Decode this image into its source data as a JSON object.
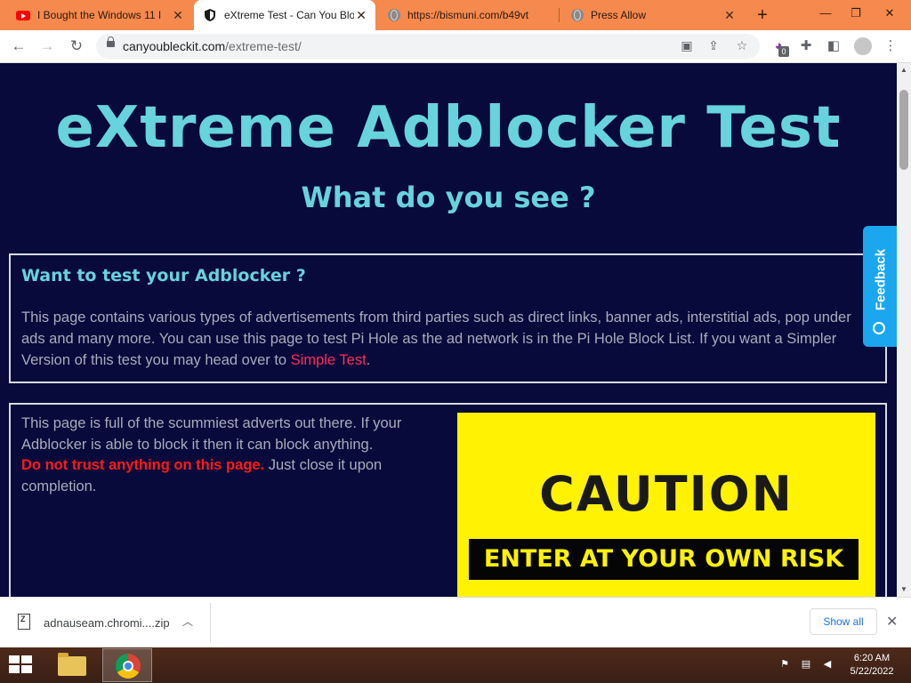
{
  "browser": {
    "tabs": [
      {
        "title": "I Bought the Windows 11 I",
        "favicon": "youtube-icon",
        "active": false
      },
      {
        "title": "eXtreme Test - Can You Blo",
        "favicon": "shield-icon",
        "active": true
      },
      {
        "title": "https://bismuni.com/b49vt",
        "favicon": "globe-icon",
        "active": false
      },
      {
        "title": "Press Allow",
        "favicon": "globe-icon",
        "active": false
      }
    ],
    "tab_close": "✕",
    "new_tab": "+",
    "window_controls": {
      "minimize": "—",
      "restore": "❐",
      "close": "✕"
    },
    "url_domain": "canyoubleckit.com",
    "url_path": "/extreme-test/",
    "extension_badge": "0"
  },
  "page": {
    "title": "eXtreme Adblocker Test",
    "subtitle": "What do you see ?",
    "intro": {
      "heading": "Want to test your Adblocker ?",
      "text_before": "This page contains various types of advertisements from third parties such as direct links, banner ads, interstitial ads, pop under ads and many more. You can use this page to test Pi Hole as the ad network is in the Pi Hole Block List. If you want a Simpler Version of this test you may head over to ",
      "link": "Simple Test",
      "text_after": "."
    },
    "warning": {
      "text_before": "This page is full of the scummiest adverts out there. If your Adblocker is able to block it then it can block anything.",
      "emphasis": "Do not trust anything on this page.",
      "text_after": " Just close it upon completion."
    },
    "caution_banner": {
      "headline": "CAUTION",
      "band": "ENTER AT YOUR OWN RISK"
    },
    "feedback_tab": "Feedback"
  },
  "download_bar": {
    "filename": "adnauseam.chromi....zip",
    "show_all": "Show all"
  },
  "taskbar": {
    "time": "6:20 AM",
    "date": "5/22/2022"
  },
  "colors": {
    "tabstrip": "#f6894d",
    "page_bg": "#070a3a",
    "heading": "#67d3dc",
    "link": "#ff2d5b",
    "caution_yellow": "#fff203",
    "feedback_blue": "#1ba7ef"
  }
}
